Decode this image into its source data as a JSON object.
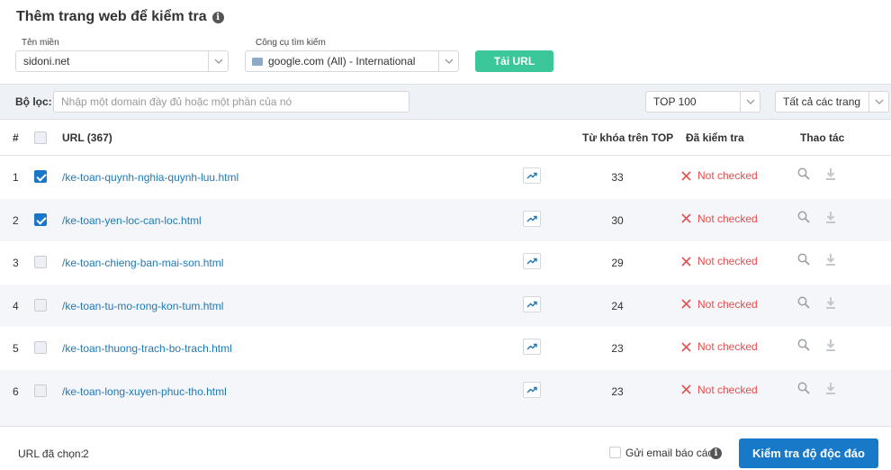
{
  "header": {
    "title": "Thêm trang web để kiểm tra",
    "info_icon": "info-icon"
  },
  "domain": {
    "label": "Tên miền",
    "value": "sidoni.net"
  },
  "engine": {
    "label": "Công cụ tìm kiếm",
    "value": "google.com (All) - International"
  },
  "load_button": "Tải URL",
  "filter": {
    "label": "Bộ lọc:",
    "placeholder": "Nhập một domain đầy đủ hoặc một phần của nó",
    "top_select": "TOP 100",
    "pages_select": "Tất cả các trang"
  },
  "table": {
    "columns": {
      "num": "#",
      "url": "URL (367)",
      "keywords": "Từ khóa trên TOP",
      "checked": "Đã kiểm tra",
      "actions": "Thao tác"
    },
    "rows": [
      {
        "num": "1",
        "url": "/ke-toan-quynh-nghia-quynh-luu.html",
        "keywords": "33",
        "status": "Not checked",
        "selected": true
      },
      {
        "num": "2",
        "url": "/ke-toan-yen-loc-can-loc.html",
        "keywords": "30",
        "status": "Not checked",
        "selected": true
      },
      {
        "num": "3",
        "url": "/ke-toan-chieng-ban-mai-son.html",
        "keywords": "29",
        "status": "Not checked",
        "selected": false
      },
      {
        "num": "4",
        "url": "/ke-toan-tu-mo-rong-kon-tum.html",
        "keywords": "24",
        "status": "Not checked",
        "selected": false
      },
      {
        "num": "5",
        "url": "/ke-toan-thuong-trach-bo-trach.html",
        "keywords": "23",
        "status": "Not checked",
        "selected": false
      },
      {
        "num": "6",
        "url": "/ke-toan-long-xuyen-phuc-tho.html",
        "keywords": "23",
        "status": "Not checked",
        "selected": false
      }
    ]
  },
  "footer": {
    "selected_label": "URL đã chọn:",
    "selected_count": "2",
    "email_label": "Gửi email báo cáo",
    "check_button": "Kiểm tra độ độc đáo"
  },
  "colors": {
    "accent_blue": "#1979c9",
    "load_green": "#3cc79a",
    "status_red": "#e44d4d",
    "link": "#1d79b8"
  }
}
